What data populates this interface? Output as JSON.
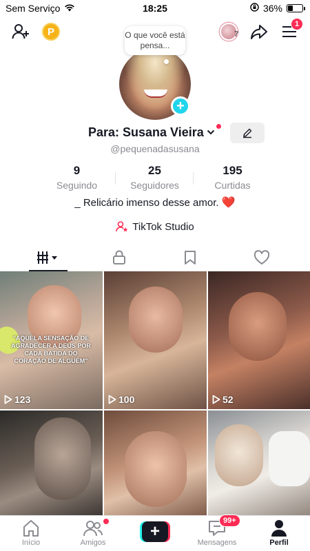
{
  "status_bar": {
    "carrier": "Sem Serviço",
    "time": "18:25",
    "battery": "36%",
    "battery_level": 0.36
  },
  "top_bar": {
    "coin_label": "P",
    "friend_count": "7",
    "menu_badge": "1",
    "thought_bubble": "O que você está pensa..."
  },
  "profile": {
    "display_name": "Para: Susana Vieira",
    "username": "@pequenadasusana",
    "bio": "_ Relicário imenso desse amor.",
    "bio_emoji": "❤️",
    "studio_label": "TikTok Studio"
  },
  "stats": [
    {
      "value": "9",
      "label": "Seguindo"
    },
    {
      "value": "25",
      "label": "Seguidores"
    },
    {
      "value": "195",
      "label": "Curtidas"
    }
  ],
  "tabs": [
    {
      "icon": "videos-grid-icon"
    },
    {
      "icon": "lock-icon"
    },
    {
      "icon": "bookmark-icon"
    },
    {
      "icon": "heart-icon"
    }
  ],
  "videos": [
    {
      "views": "123",
      "caption": "\"AQUELA SENSAÇÃO DE AGRADECER A DEUS POR CADA BATIDA DO CORAÇÃO DE ALGUÉM\""
    },
    {
      "views": "100"
    },
    {
      "views": "52"
    },
    {
      "views": ""
    },
    {
      "views": ""
    },
    {
      "views": ""
    }
  ],
  "bottom_nav": {
    "items": [
      {
        "label": "Início",
        "icon": "home-icon"
      },
      {
        "label": "Amigos",
        "icon": "friends-icon"
      },
      {
        "label": "",
        "icon": "create-icon"
      },
      {
        "label": "Mensagens",
        "icon": "inbox-icon"
      },
      {
        "label": "Perfil",
        "icon": "profile-icon"
      }
    ],
    "messages_badge": "99+"
  },
  "colors": {
    "accent": "#fe2c55",
    "cyan": "#25f4ee",
    "text": "#161823",
    "muted": "#8a8b91"
  }
}
